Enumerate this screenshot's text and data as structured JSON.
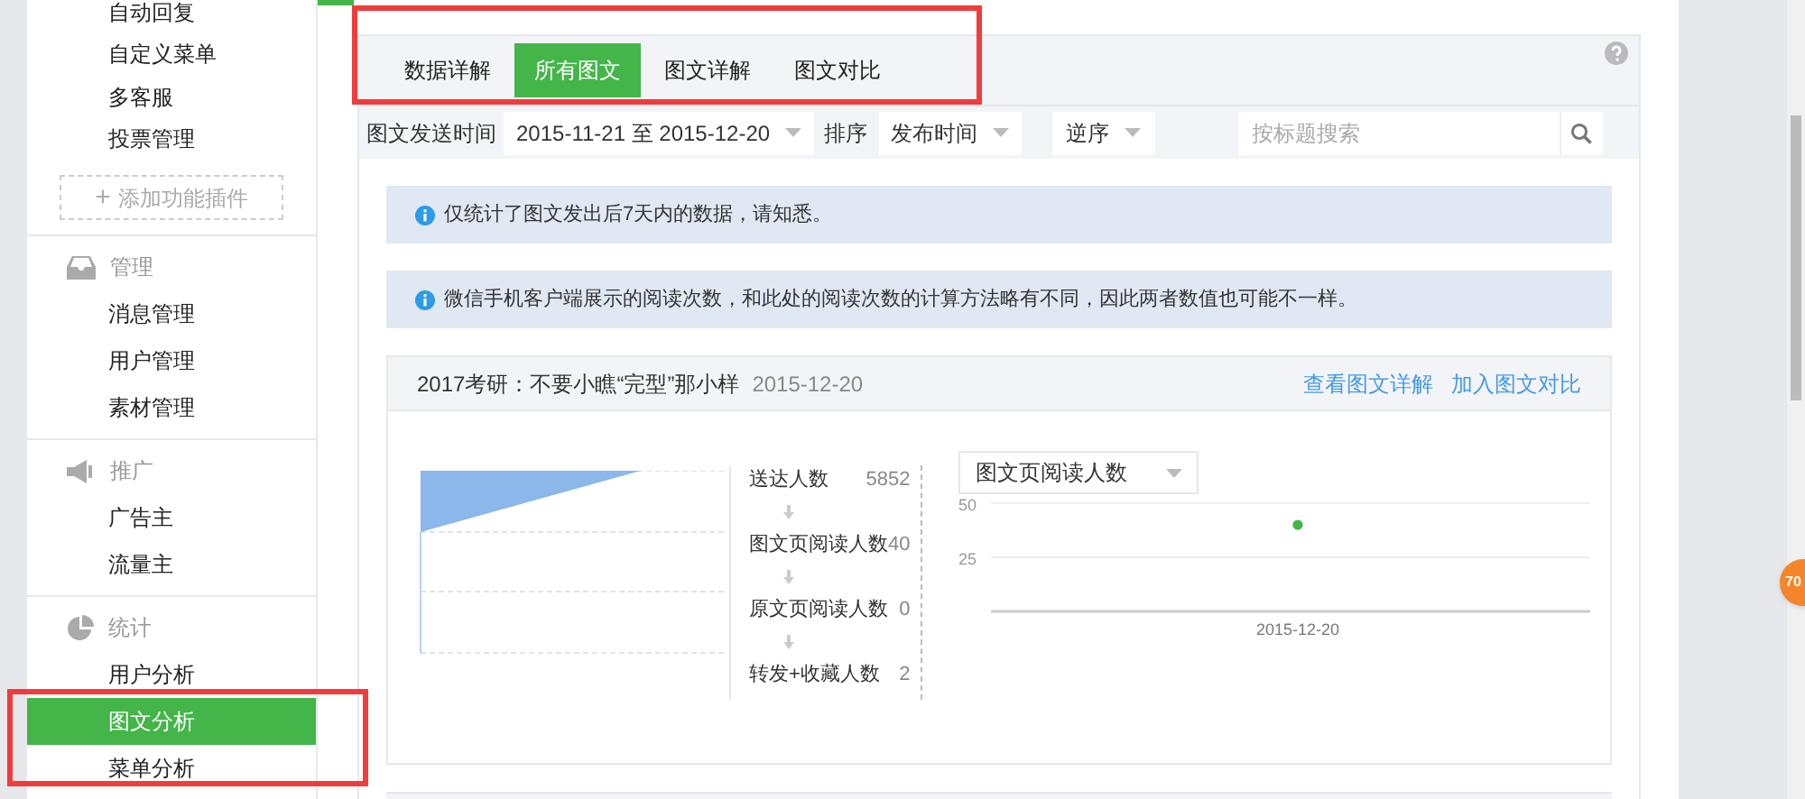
{
  "sidebar": {
    "top_items": [
      {
        "label": "自动回复",
        "selected": false
      },
      {
        "label": "自定义菜单",
        "selected": false
      },
      {
        "label": "多客服",
        "selected": false
      },
      {
        "label": "投票管理",
        "selected": false
      }
    ],
    "add_plugin": {
      "icon": "+",
      "label": "添加功能插件"
    },
    "sections": [
      {
        "kind": "inbox",
        "title": "管理",
        "items": [
          {
            "label": "消息管理",
            "selected": false
          },
          {
            "label": "用户管理",
            "selected": false
          },
          {
            "label": "素材管理",
            "selected": false
          }
        ]
      },
      {
        "kind": "megaphone",
        "title": "推广",
        "items": [
          {
            "label": "广告主",
            "selected": false
          },
          {
            "label": "流量主",
            "selected": false
          }
        ]
      },
      {
        "kind": "pie",
        "title": "统计",
        "items": [
          {
            "label": "用户分析",
            "selected": false
          },
          {
            "label": "图文分析",
            "selected": true
          },
          {
            "label": "菜单分析",
            "selected": false
          }
        ]
      }
    ]
  },
  "tabs": [
    {
      "label": "数据详解",
      "selected": false
    },
    {
      "label": "所有图文",
      "selected": true
    },
    {
      "label": "图文详解",
      "selected": false
    },
    {
      "label": "图文对比",
      "selected": false
    }
  ],
  "filters": {
    "date_label": "图文发送时间",
    "date_range": "2015-11-21 至 2015-12-20",
    "sort_label": "排序",
    "sort_by": "发布时间",
    "order": "逆序",
    "search": {
      "placeholder": "按标题搜索"
    }
  },
  "notices": [
    "仅统计了图文发出后7天内的数据，请知悉。",
    "微信手机客户端展示的阅读次数，和此处的阅读次数的计算方法略有不同，因此两者数值也可能不一样。"
  ],
  "article": {
    "title": "2017考研：不要小瞧“完型”那小样",
    "date": "2015-12-20",
    "links": [
      "查看图文详解",
      "加入图文对比"
    ],
    "funnel": [
      {
        "label": "送达人数",
        "value": "5852"
      },
      {
        "label": "图文页阅读人数",
        "value": "40"
      },
      {
        "label": "原文页阅读人数",
        "value": "0"
      },
      {
        "label": "转发+收藏人数",
        "value": "2"
      }
    ],
    "chart_data": {
      "type": "scatter",
      "categories": [
        "2015-12-20"
      ],
      "series": [
        {
          "name": "图文页阅读人数",
          "color": "#44b549",
          "values": [
            40
          ]
        }
      ],
      "ylim": [
        0,
        50
      ],
      "yticks": [
        25,
        50
      ]
    }
  },
  "badge": "70"
}
